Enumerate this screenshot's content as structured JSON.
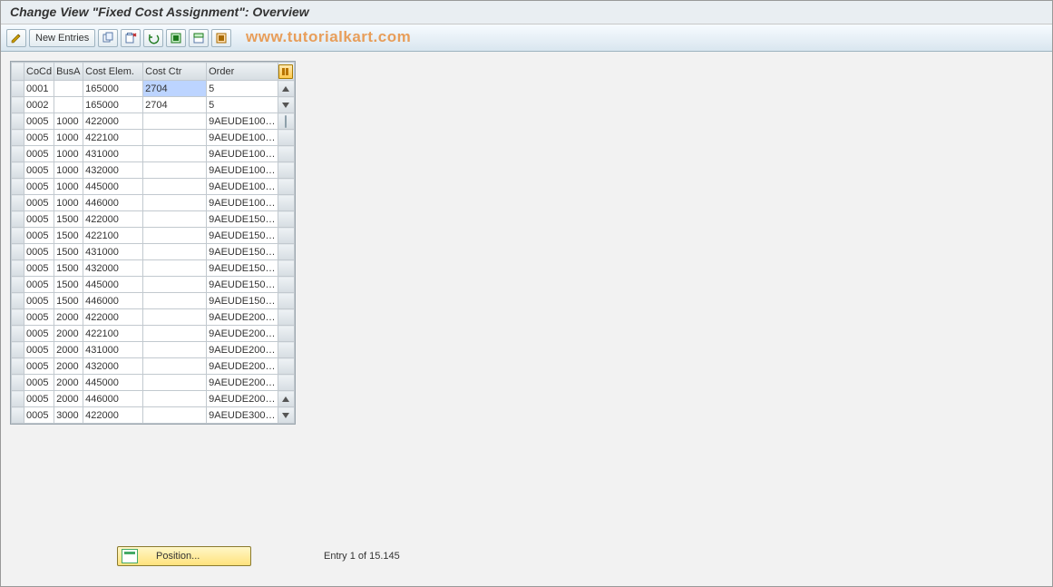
{
  "title": "Change View \"Fixed Cost Assignment\": Overview",
  "watermark": "www.tutorialkart.com",
  "toolbar": {
    "new_entries_label": "New Entries"
  },
  "columns": {
    "cocd": "CoCd",
    "busa": "BusA",
    "costelem": "Cost Elem.",
    "costctr": "Cost Ctr",
    "order": "Order"
  },
  "rows": [
    {
      "cocd": "0001",
      "busa": "",
      "costelem": "165000",
      "costctr": "2704",
      "order": "5",
      "selected_cell": "costctr"
    },
    {
      "cocd": "0002",
      "busa": "",
      "costelem": "165000",
      "costctr": "2704",
      "order": "5"
    },
    {
      "cocd": "0005",
      "busa": "1000",
      "costelem": "422000",
      "costctr": "",
      "order": "9AEUDE100…"
    },
    {
      "cocd": "0005",
      "busa": "1000",
      "costelem": "422100",
      "costctr": "",
      "order": "9AEUDE100…"
    },
    {
      "cocd": "0005",
      "busa": "1000",
      "costelem": "431000",
      "costctr": "",
      "order": "9AEUDE100…"
    },
    {
      "cocd": "0005",
      "busa": "1000",
      "costelem": "432000",
      "costctr": "",
      "order": "9AEUDE100…"
    },
    {
      "cocd": "0005",
      "busa": "1000",
      "costelem": "445000",
      "costctr": "",
      "order": "9AEUDE100…"
    },
    {
      "cocd": "0005",
      "busa": "1000",
      "costelem": "446000",
      "costctr": "",
      "order": "9AEUDE100…"
    },
    {
      "cocd": "0005",
      "busa": "1500",
      "costelem": "422000",
      "costctr": "",
      "order": "9AEUDE150…"
    },
    {
      "cocd": "0005",
      "busa": "1500",
      "costelem": "422100",
      "costctr": "",
      "order": "9AEUDE150…"
    },
    {
      "cocd": "0005",
      "busa": "1500",
      "costelem": "431000",
      "costctr": "",
      "order": "9AEUDE150…"
    },
    {
      "cocd": "0005",
      "busa": "1500",
      "costelem": "432000",
      "costctr": "",
      "order": "9AEUDE150…"
    },
    {
      "cocd": "0005",
      "busa": "1500",
      "costelem": "445000",
      "costctr": "",
      "order": "9AEUDE150…"
    },
    {
      "cocd": "0005",
      "busa": "1500",
      "costelem": "446000",
      "costctr": "",
      "order": "9AEUDE150…"
    },
    {
      "cocd": "0005",
      "busa": "2000",
      "costelem": "422000",
      "costctr": "",
      "order": "9AEUDE200…"
    },
    {
      "cocd": "0005",
      "busa": "2000",
      "costelem": "422100",
      "costctr": "",
      "order": "9AEUDE200…"
    },
    {
      "cocd": "0005",
      "busa": "2000",
      "costelem": "431000",
      "costctr": "",
      "order": "9AEUDE200…"
    },
    {
      "cocd": "0005",
      "busa": "2000",
      "costelem": "432000",
      "costctr": "",
      "order": "9AEUDE200…"
    },
    {
      "cocd": "0005",
      "busa": "2000",
      "costelem": "445000",
      "costctr": "",
      "order": "9AEUDE200…"
    },
    {
      "cocd": "0005",
      "busa": "2000",
      "costelem": "446000",
      "costctr": "",
      "order": "9AEUDE200…"
    },
    {
      "cocd": "0005",
      "busa": "3000",
      "costelem": "422000",
      "costctr": "",
      "order": "9AEUDE300…"
    }
  ],
  "footer": {
    "position_label": "Position...",
    "entry_text": "Entry 1 of 15.145"
  }
}
